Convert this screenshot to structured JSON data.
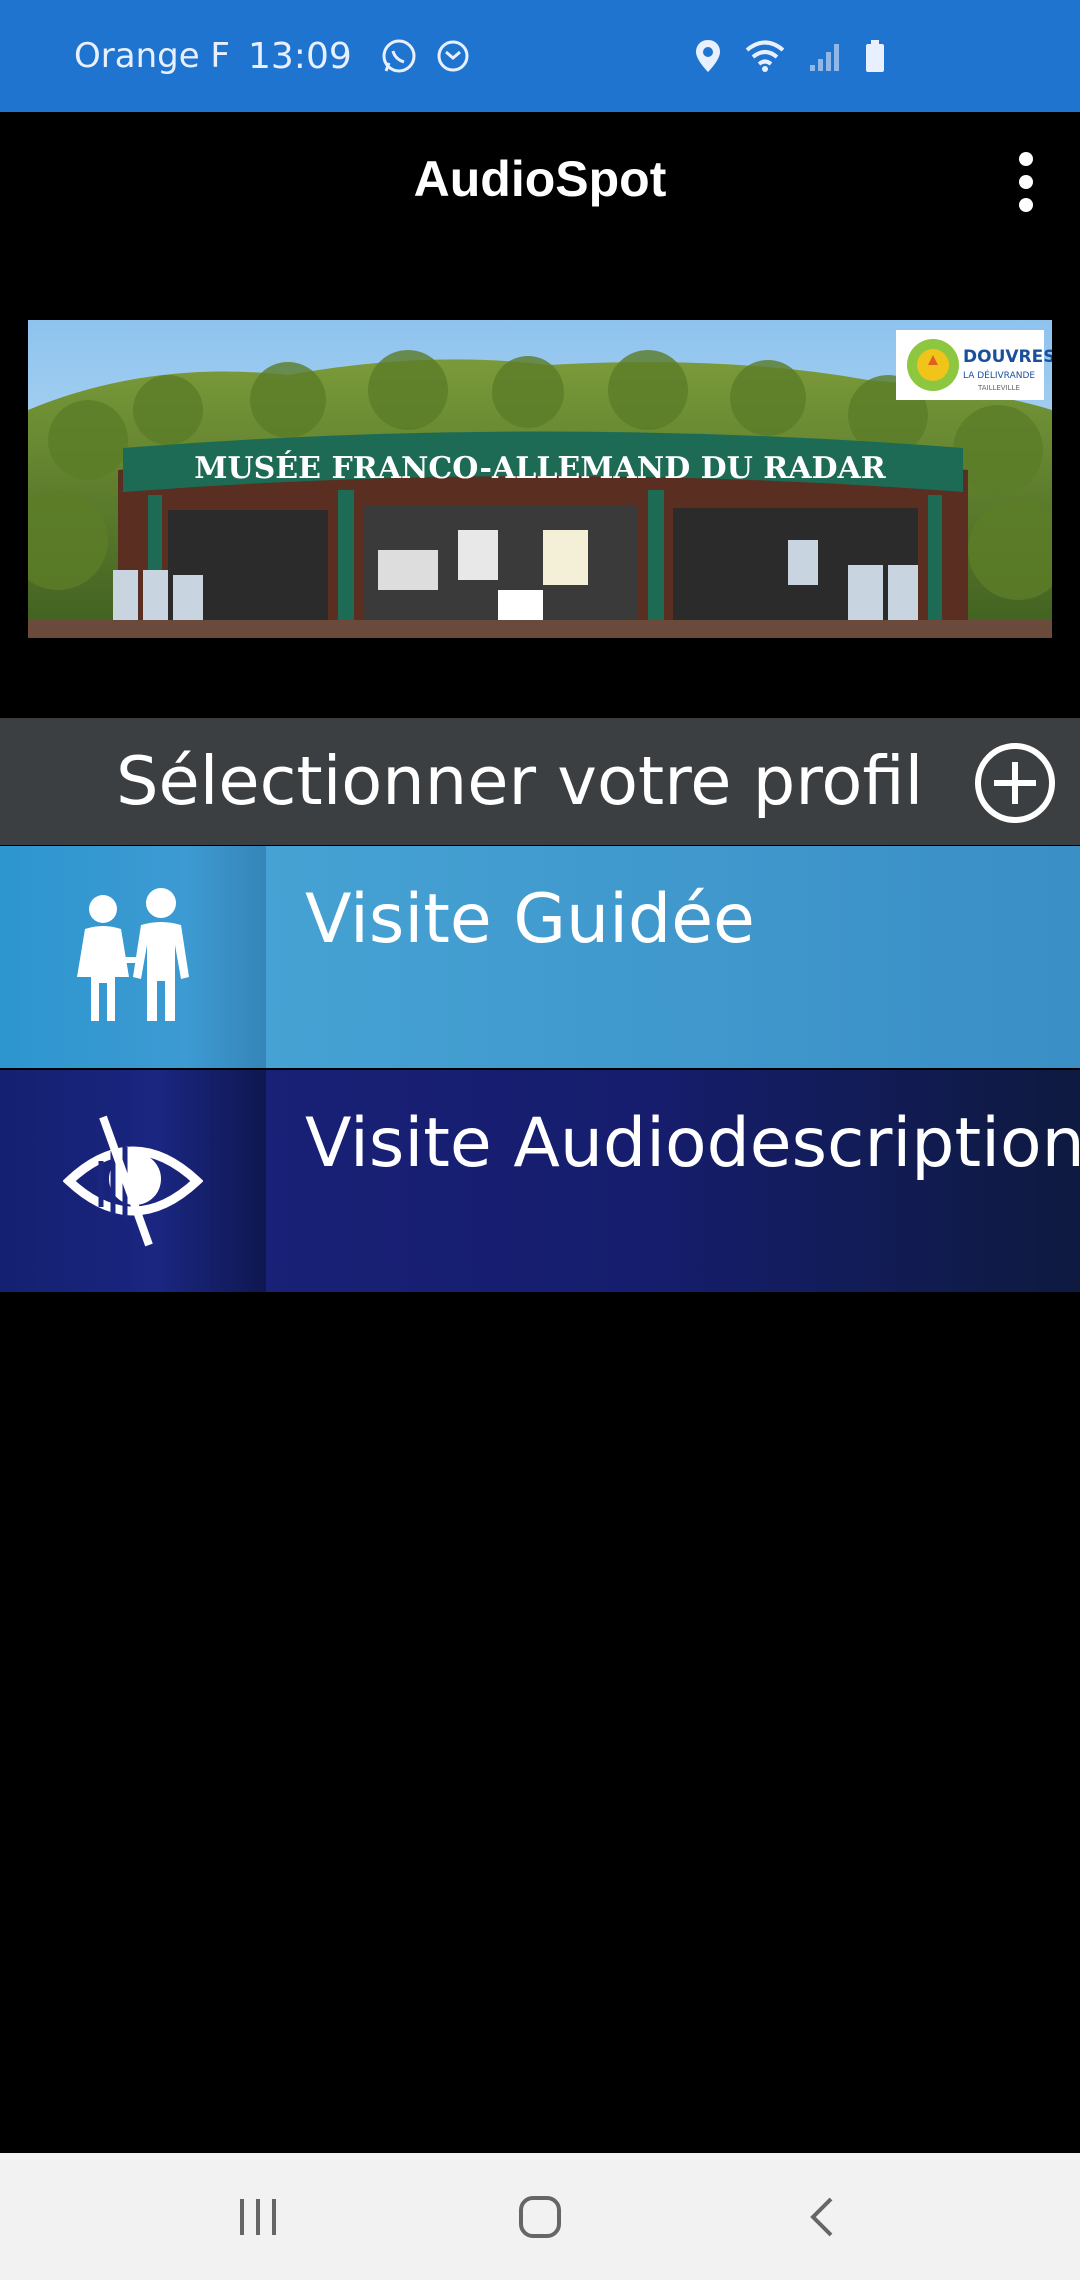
{
  "status_bar": {
    "carrier": "Orange F",
    "time": "13:09",
    "left_icons": [
      "whatsapp-icon",
      "message-icon"
    ],
    "right_icons": [
      "location-icon",
      "wifi-icon",
      "signal-icon",
      "battery-icon"
    ],
    "background": "#1f74d0"
  },
  "app_bar": {
    "title": "AudioSpot",
    "menu_icon": "more-vertical-icon"
  },
  "banner": {
    "sign_text": "MUSÉE FRANCO-ALLEMAND DU RADAR",
    "logo_text_1": "DOUVRES",
    "logo_text_2": "LA DÉLIVRANDE",
    "logo_text_3": "TAILLEVILLE"
  },
  "profile": {
    "title": "Sélectionner votre profil",
    "add_icon": "add-circle-icon",
    "bar_color": "#3c3f41",
    "options": [
      {
        "label": "Visite Guidée",
        "icon": "people-icon",
        "color": "#3a8fc6"
      },
      {
        "label": "Visite Audiodescription",
        "icon": "low-vision-eye-icon",
        "color": "#1a237e"
      }
    ]
  },
  "nav_bar": {
    "buttons": [
      "recent-apps-icon",
      "home-icon",
      "back-icon"
    ]
  }
}
